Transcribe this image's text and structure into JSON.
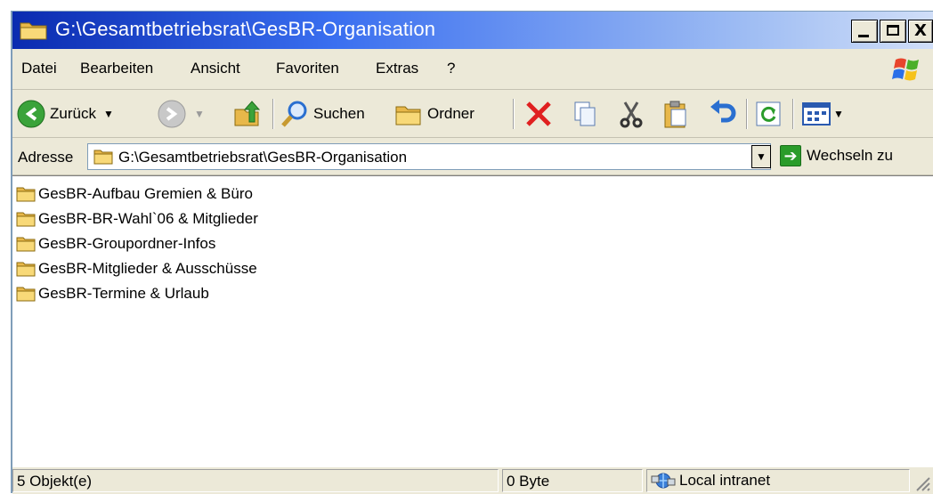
{
  "window": {
    "title": "G:\\Gesamtbetriebsrat\\GesBR-Organisation",
    "title_icon": "folder-icon",
    "controls": [
      "minimize-icon",
      "maximize-icon",
      "close-icon"
    ],
    "close_glyph": "X",
    "titlebar_color": "#0a2bb0"
  },
  "menubar": {
    "items": [
      "Datei",
      "Bearbeiten",
      "Ansicht",
      "Favoriten",
      "Extras",
      "?"
    ],
    "logo": "windows-logo-icon"
  },
  "toolbar": {
    "back_label": "Zurück",
    "search_label": "Suchen",
    "folders_label": "Ordner",
    "icons": [
      "back-arrow-icon",
      "forward-arrow-icon",
      "up-folder-icon",
      "search-icon",
      "folders-icon",
      "delete-icon",
      "copy-icon",
      "cut-icon",
      "paste-icon",
      "undo-icon",
      "refresh-icon",
      "views-icon"
    ]
  },
  "address": {
    "label": "Adresse",
    "value": "G:\\Gesamtbetriebsrat\\GesBR-Organisation",
    "go_label": "Wechseln zu"
  },
  "files": [
    {
      "name": "GesBR-Aufbau Gremien & Büro",
      "icon": "folder-icon"
    },
    {
      "name": "GesBR-BR-Wahl`06 & Mitglieder",
      "icon": "folder-icon"
    },
    {
      "name": "GesBR-Groupordner-Infos",
      "icon": "folder-icon"
    },
    {
      "name": "GesBR-Mitglieder & Ausschüsse",
      "icon": "folder-icon"
    },
    {
      "name": "GesBR-Termine & Urlaub",
      "icon": "folder-icon"
    }
  ],
  "statusbar": {
    "objects": "5 Objekt(e)",
    "size": "0 Byte",
    "zone": "Local intranet",
    "zone_icon": "local-intranet-icon"
  }
}
